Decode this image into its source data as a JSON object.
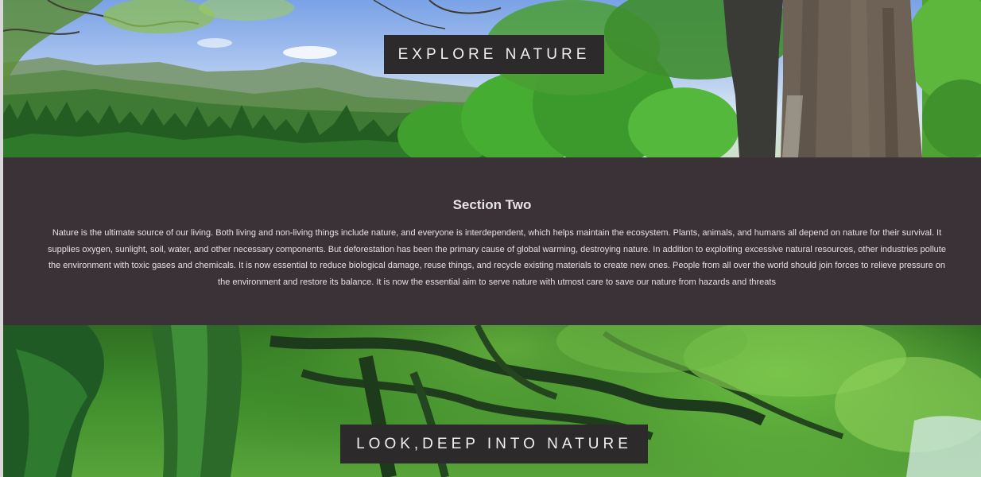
{
  "hero_top": {
    "banner_text": "EXPLORE NATURE"
  },
  "section_two": {
    "heading": "Section Two",
    "body": "Nature is the ultimate source of our living. Both living and non-living things include nature, and everyone is interdependent, which helps maintain the ecosystem. Plants, animals, and humans all depend on nature for their survival. It supplies oxygen, sunlight, soil, water, and other necessary components. But deforestation has been the primary cause of global warming, destroying nature. In addition to exploiting excessive natural resources, other industries pollute the environment with toxic gases and chemicals. It is now essential to reduce biological damage, reuse things, and recycle existing materials to create new ones. People from all over the world should join forces to relieve pressure on the environment and restore its balance. It is now the essential aim to serve nature with utmost care to save our nature from hazards and threats"
  },
  "hero_bottom": {
    "banner_text": "LOOK,DEEP INTO NATURE"
  },
  "colors": {
    "section_bg": "#3a3237",
    "banner_bg": "#2c2a2b",
    "banner_text": "#f1f1f1"
  }
}
